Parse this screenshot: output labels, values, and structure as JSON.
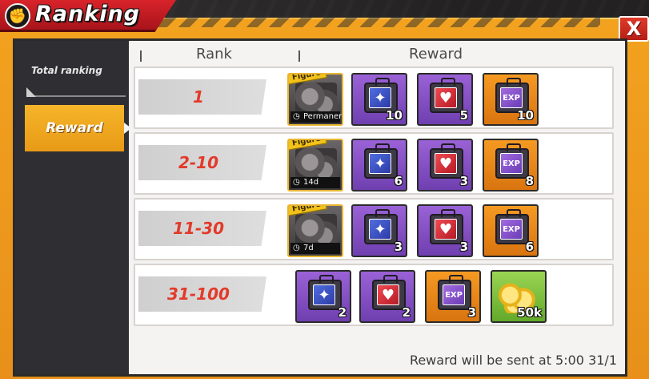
{
  "title": "Ranking",
  "close_label": "X",
  "sidebar": {
    "items": [
      {
        "label": "Total ranking",
        "active": false
      },
      {
        "label": "Reward",
        "active": true
      }
    ]
  },
  "table": {
    "headers": {
      "rank": "Rank",
      "reward": "Reward"
    },
    "rows": [
      {
        "rank": "1",
        "rewards": [
          {
            "type": "figure",
            "tag": "Figure",
            "duration": "Permanent",
            "icon": "figure-portrait"
          },
          {
            "type": "case",
            "color": "purple",
            "icon": "card-case",
            "quantity": "10"
          },
          {
            "type": "case",
            "color": "purple",
            "icon": "red-card-case",
            "quantity": "5"
          },
          {
            "type": "case",
            "color": "orange",
            "icon": "exp-case",
            "quantity": "10"
          }
        ]
      },
      {
        "rank": "2-10",
        "rewards": [
          {
            "type": "figure",
            "tag": "Figure",
            "duration": "14d",
            "icon": "figure-portrait"
          },
          {
            "type": "case",
            "color": "purple",
            "icon": "card-case",
            "quantity": "6"
          },
          {
            "type": "case",
            "color": "purple",
            "icon": "red-card-case",
            "quantity": "3"
          },
          {
            "type": "case",
            "color": "orange",
            "icon": "exp-case",
            "quantity": "8"
          }
        ]
      },
      {
        "rank": "11-30",
        "rewards": [
          {
            "type": "figure",
            "tag": "Figure",
            "duration": "7d",
            "icon": "figure-portrait"
          },
          {
            "type": "case",
            "color": "purple",
            "icon": "card-case",
            "quantity": "3"
          },
          {
            "type": "case",
            "color": "purple",
            "icon": "red-card-case",
            "quantity": "3"
          },
          {
            "type": "case",
            "color": "orange",
            "icon": "exp-case",
            "quantity": "6"
          }
        ]
      },
      {
        "rank": "31-100",
        "rewards": [
          {
            "type": "case",
            "color": "purple",
            "icon": "card-case",
            "quantity": "2"
          },
          {
            "type": "case",
            "color": "purple",
            "icon": "red-card-case",
            "quantity": "2"
          },
          {
            "type": "case",
            "color": "orange",
            "icon": "exp-case",
            "quantity": "3"
          },
          {
            "type": "coins",
            "color": "green",
            "icon": "gold-coins",
            "quantity": "50k"
          }
        ]
      }
    ]
  },
  "footer": "Reward will be sent at 5:00 31/1"
}
